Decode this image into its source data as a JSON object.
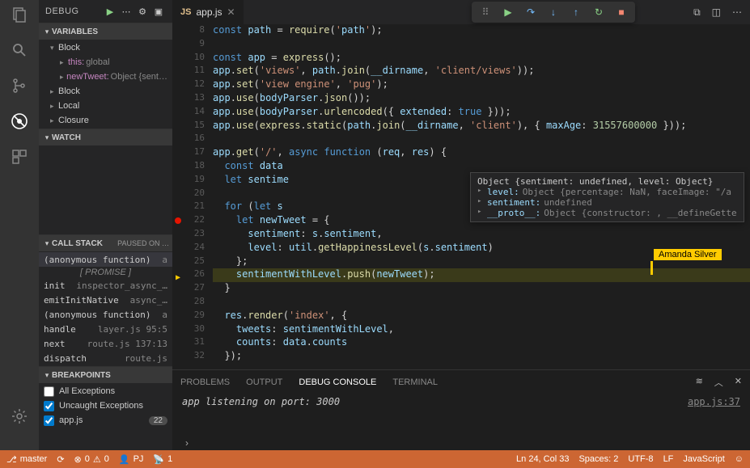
{
  "sidebar": {
    "title": "DEBUG",
    "variables": {
      "title": "VARIABLES",
      "groups": [
        {
          "name": "Block",
          "open": true,
          "items": [
            {
              "k": "this:",
              "v": "global"
            },
            {
              "k": "newTweet:",
              "v": "Object {sent…"
            }
          ]
        },
        {
          "name": "Block",
          "open": false,
          "items": []
        },
        {
          "name": "Local",
          "open": false,
          "items": []
        },
        {
          "name": "Closure",
          "open": false,
          "items": []
        }
      ]
    },
    "watch": {
      "title": "WATCH"
    },
    "callstack": {
      "title": "CALL STACK",
      "tag": "PAUSED ON …",
      "promise": "[ PROMISE ]",
      "frames": [
        {
          "fn": "(anonymous function)",
          "loc": "a",
          "sel": true
        },
        {
          "fn": "init",
          "loc": "inspector_async_…"
        },
        {
          "fn": "emitInitNative",
          "loc": "async_…"
        },
        {
          "fn": "(anonymous function)",
          "loc": "a"
        },
        {
          "fn": "handle",
          "loc": "layer.js  95:5"
        },
        {
          "fn": "next",
          "loc": "route.js  137:13"
        },
        {
          "fn": "dispatch",
          "loc": "route.js"
        }
      ]
    },
    "breakpoints": {
      "title": "BREAKPOINTS",
      "items": [
        {
          "label": "All Exceptions",
          "checked": false
        },
        {
          "label": "Uncaught Exceptions",
          "checked": true
        },
        {
          "label": "app.js",
          "checked": true,
          "badge": "22"
        }
      ]
    }
  },
  "tab": {
    "icon": "JS",
    "name": "app.js"
  },
  "hover": {
    "header": "Object {sentiment: undefined, level: Object}",
    "rows": [
      {
        "k": "level:",
        "v": "Object {percentage: NaN, faceImage: \"/a"
      },
      {
        "k": "sentiment:",
        "v": "undefined"
      },
      {
        "k": "__proto__:",
        "v": "Object {constructor: , __defineGette"
      }
    ]
  },
  "nametag": "Amanda Silver",
  "panel": {
    "tabs": [
      "PROBLEMS",
      "OUTPUT",
      "DEBUG CONSOLE",
      "TERMINAL"
    ],
    "active": 2,
    "output": "app listening on port: 3000",
    "loc": "app.js:37"
  },
  "status": {
    "branch": "master",
    "errors": "0",
    "warnings": "0",
    "user": "PJ",
    "live": "1",
    "cursor": "Ln 24, Col 33",
    "spaces": "Spaces: 2",
    "encoding": "UTF-8",
    "eol": "LF",
    "lang": "JavaScript"
  },
  "code": {
    "start": 8,
    "lines": [
      "const path = require('path');",
      "",
      "const app = express();",
      "app.set('views', path.join(__dirname, 'client/views'));",
      "app.set('view engine', 'pug');",
      "app.use(bodyParser.json());",
      "app.use(bodyParser.urlencoded({ extended: true }));",
      "app.use(express.static(path.join(__dirname, 'client'), { maxAge: 31557600000 }));",
      "",
      "app.get('/', async function (req, res) {",
      "  const data",
      "  let sentime",
      "",
      "  for (let s",
      "    let newTweet = {",
      "      sentiment: s.sentiment,",
      "      level: util.getHappinessLevel(s.sentiment)",
      "    };",
      "    sentimentWithLevel.push(newTweet);",
      "  }",
      "",
      "  res.render('index', {",
      "    tweets: sentimentWithLevel,",
      "    counts: data.counts",
      "  });"
    ]
  }
}
